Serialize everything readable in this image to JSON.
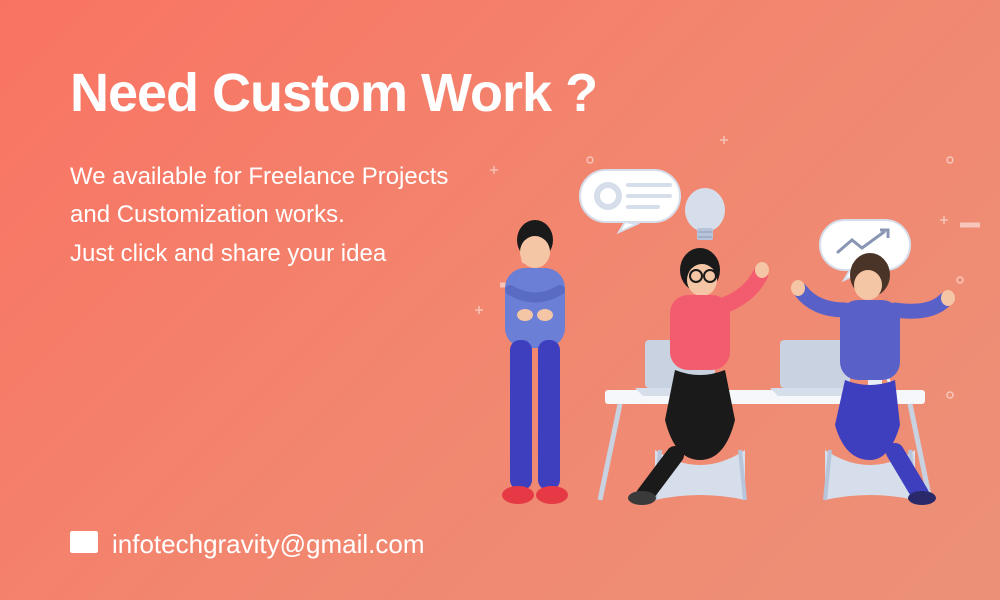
{
  "heading": "Need Custom Work ?",
  "subtext_line1": "We available for Freelance Projects",
  "subtext_line2": "and Customization works.",
  "subtext_line3": "Just click and share your idea",
  "contact_email": "infotechgravity@gmail.com"
}
